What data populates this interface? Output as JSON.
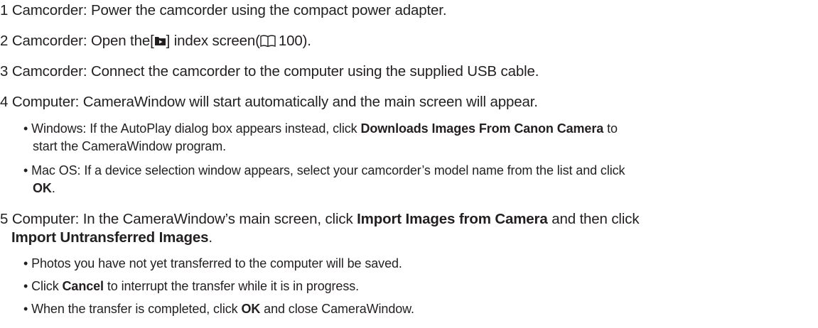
{
  "steps": [
    {
      "num": "1",
      "text": "Camcorder: Power the camcorder using the compact power adapter."
    },
    {
      "num": "2",
      "text_a": "Camcorder: Open the",
      "icon": "playback-folder-icon",
      "text_b": "index screen",
      "ref_icon": "book-reference-icon",
      "page_ref": "100"
    },
    {
      "num": "3",
      "text": "Camcorder: Connect the camcorder to the computer using the supplied USB cable."
    },
    {
      "num": "4",
      "text": "Computer: CameraWindow will start automatically and the main screen will appear."
    },
    {
      "num": "5",
      "text_a": "Computer: In the CameraWindow’s main screen, click",
      "bold1": "Import Images from Camera",
      "text_b": "and then click",
      "bold2": "Import Untransferred Images",
      "end": "."
    }
  ],
  "bullets": {
    "windows": {
      "a": "Windows: If the AutoPlay dialog box appears instead, click",
      "bold": "Downloads Images From Canon Camera",
      "b": "to",
      "c": "start the CameraWindow program."
    },
    "mac": {
      "a": "Mac OS: If a device selection window appears, select your camcorder’s model name from the list and click",
      "bold": "OK",
      "end": "."
    },
    "photos": "Photos you have not yet transferred to the computer will be saved.",
    "cancel": {
      "a": "Click",
      "bold": "Cancel",
      "b": "to interrupt the transfer while it is in progress."
    },
    "complete": {
      "a": "When the transfer is completed, click",
      "bold": "OK",
      "b": "and close CameraWindow."
    }
  },
  "colors": {
    "text": "#231f20",
    "background": "#ffffff"
  }
}
